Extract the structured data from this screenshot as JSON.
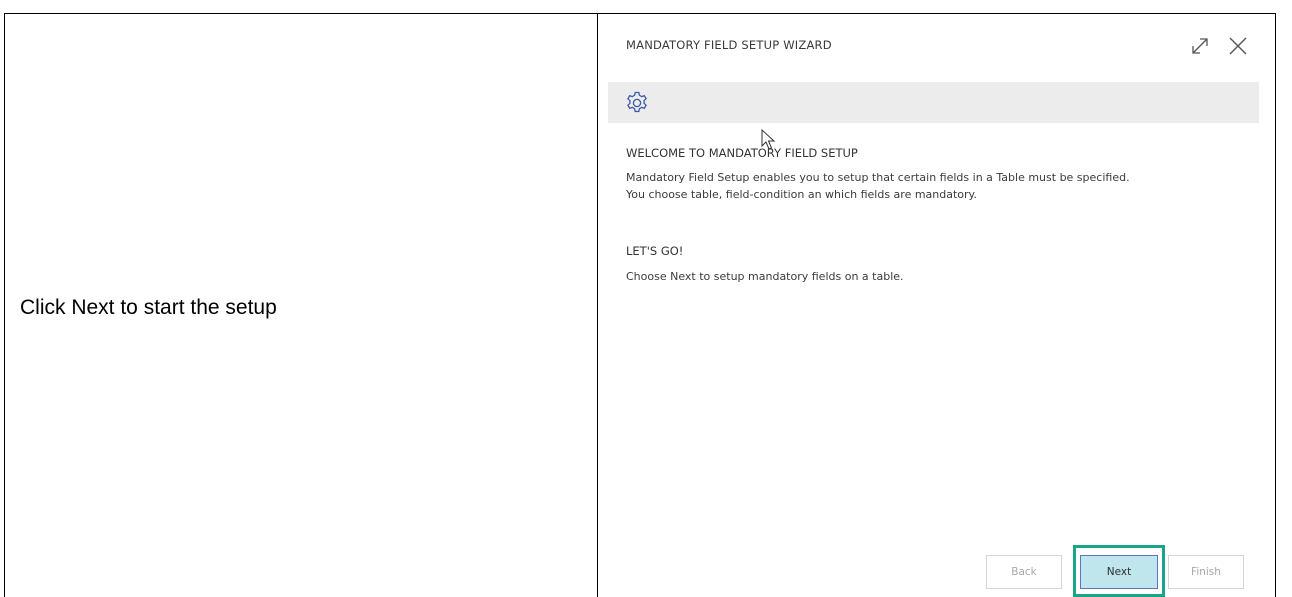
{
  "instruction": {
    "text": "Click Next to start the setup"
  },
  "wizard": {
    "title": "MANDATORY FIELD SETUP WIZARD",
    "expand_icon": "expand-icon",
    "close_icon": "close-icon",
    "banner_icon": "gear-icon",
    "welcome": {
      "heading": "WELCOME TO MANDATORY FIELD SETUP",
      "line1": "Mandatory Field Setup enables you to setup that certain fields in a Table must be specified.",
      "line2": "You choose table, field-condition an which fields are mandatory."
    },
    "lets_go": {
      "heading": "LET'S GO!",
      "text": "Choose Next to setup mandatory fields on a table."
    },
    "buttons": {
      "back": "Back",
      "next": "Next",
      "finish": "Finish"
    }
  },
  "colors": {
    "highlight": "#1aa589",
    "next_button": "#bfe6ec",
    "banner": "#ececec",
    "icon": "#3b5aa8"
  }
}
